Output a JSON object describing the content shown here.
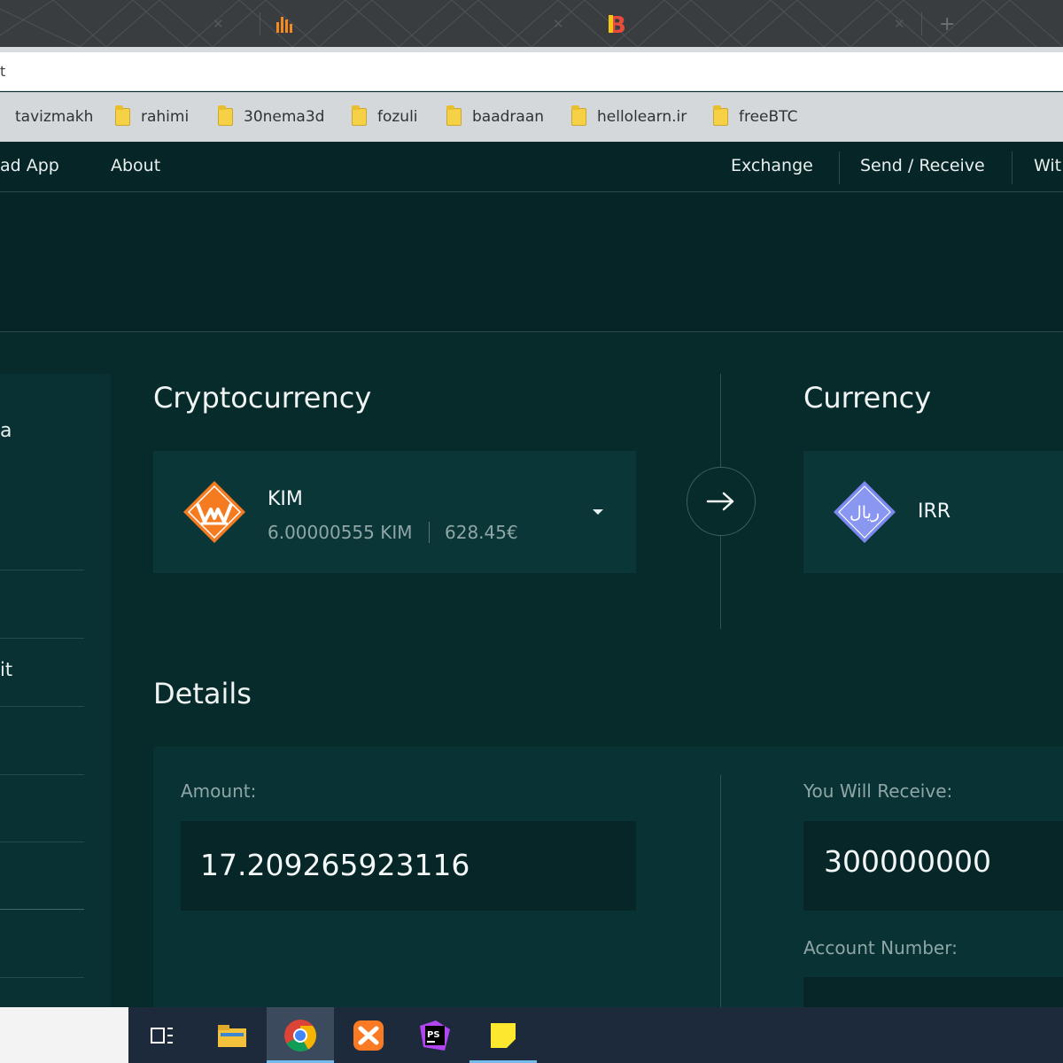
{
  "browser": {
    "url_fragment": "t",
    "bookmarks": [
      {
        "label": "tavizmakh"
      },
      {
        "label": "rahimi"
      },
      {
        "label": "30nema3d"
      },
      {
        "label": "fozuli"
      },
      {
        "label": "baadraan"
      },
      {
        "label": "hellolearn.ir"
      },
      {
        "label": "freeBTC"
      }
    ]
  },
  "nav": {
    "left": [
      "ad App",
      "About"
    ],
    "right": [
      "Exchange",
      "Send / Receive",
      "Wit"
    ]
  },
  "sidebar": {
    "items": [
      "a",
      "it"
    ]
  },
  "crypto": {
    "title": "Cryptocurrency",
    "coin": "KIM",
    "balance": "6.00000555 KIM",
    "value": "628.45€"
  },
  "currency": {
    "title": "Currency",
    "coin": "IRR",
    "icon_text": "ریال"
  },
  "details": {
    "title": "Details",
    "amount_label": "Amount:",
    "amount_value": "17.209265923116",
    "receive_label": "You Will Receive:",
    "receive_value": "300000000",
    "account_label": "Account Number:"
  },
  "colors": {
    "background": "#062a2b",
    "card": "#0a3638",
    "kim_orange": "#f47b20",
    "irr_purple": "#7b89ee"
  },
  "icons": {
    "arrow": "arrow-right-icon",
    "taskbar": [
      "task-view-icon",
      "file-explorer-icon",
      "chrome-icon",
      "xampp-icon",
      "phpstorm-icon",
      "sticky-notes-icon"
    ]
  }
}
